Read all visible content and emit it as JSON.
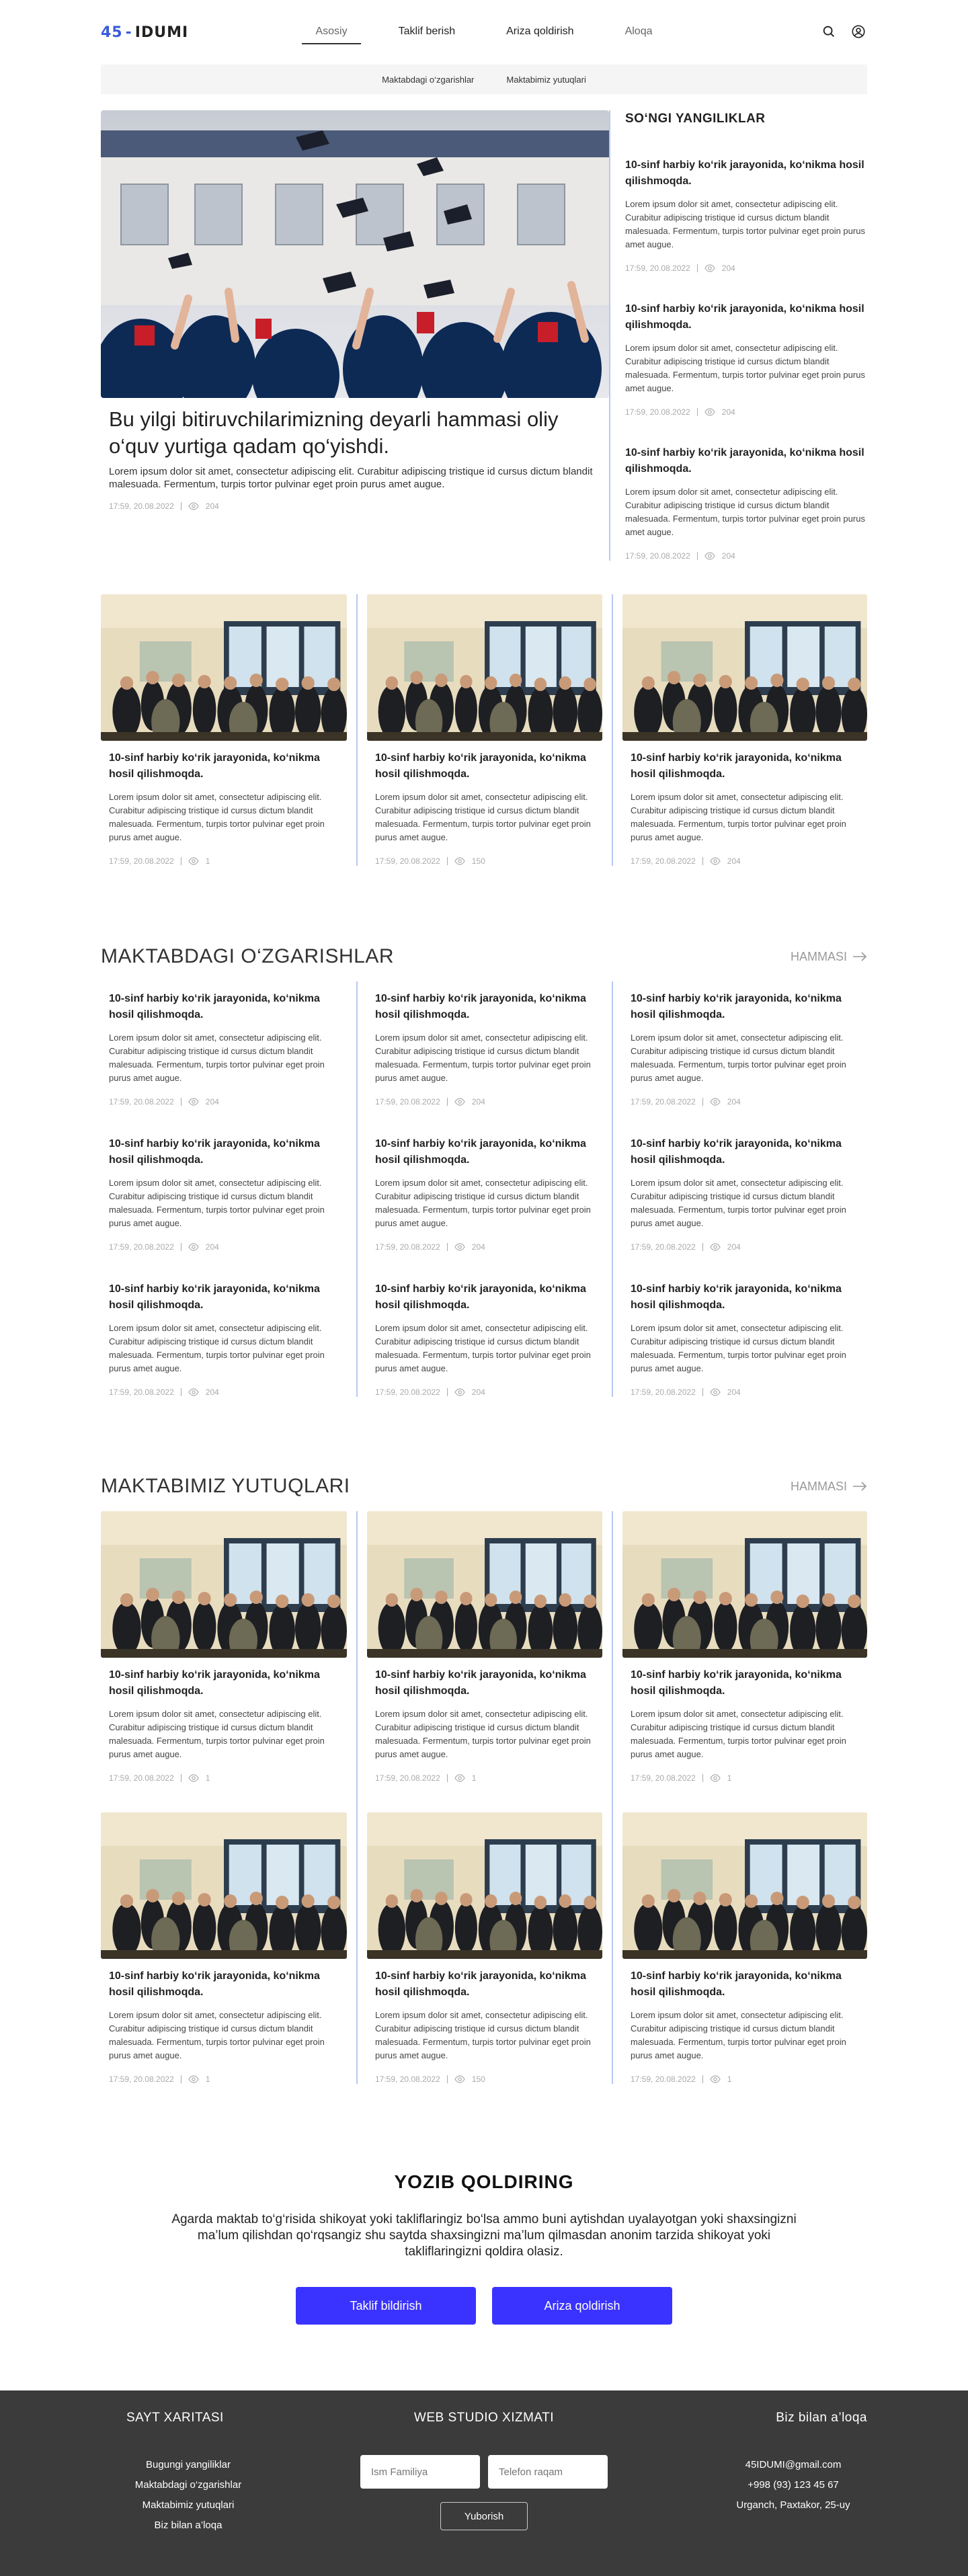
{
  "header": {
    "logo_num": "45",
    "logo_sep": "-",
    "logo_text": "IDUMI",
    "nav": [
      "Asosiy",
      "Taklif berish",
      "Ariza qoldirish",
      "Aloqa"
    ],
    "icons": [
      "search-icon",
      "user-icon"
    ]
  },
  "subnav": [
    "Maktabdagi o‘zgarishlar",
    "Maktabimiz yutuqlari"
  ],
  "featured": {
    "title": "Bu yilgi bitiruvchilarimizning deyarli hammasi oliy o‘quv yurtiga qadam qo‘yishdi.",
    "desc": "Lorem ipsum dolor sit amet, consectetur adipiscing elit. Curabitur adipiscing tristique id cursus dictum blandit malesuada. Fermentum, turpis tortor pulvinar eget proin purus amet augue.",
    "date": "17:59, 20.08.2022",
    "views": "204"
  },
  "latest": {
    "heading": "SO‘NGI YANGILIKLAR",
    "items": [
      {
        "title": "10-sinf  harbiy ko‘rik jarayonida, ko‘nikma hosil qilishmoqda.",
        "desc": "Lorem ipsum dolor sit amet, consectetur adipiscing elit. Curabitur adipiscing tristique id cursus dictum blandit malesuada. Fermentum, turpis tortor pulvinar eget proin purus amet augue.",
        "date": "17:59, 20.08.2022",
        "views": "204"
      },
      {
        "title": "10-sinf  harbiy ko‘rik jarayonida, ko‘nikma hosil qilishmoqda.",
        "desc": "Lorem ipsum dolor sit amet, consectetur adipiscing elit. Curabitur adipiscing tristique id cursus dictum blandit malesuada. Fermentum, turpis tortor pulvinar eget proin purus amet augue.",
        "date": "17:59, 20.08.2022",
        "views": "204"
      },
      {
        "title": "10-sinf  harbiy ko‘rik jarayonida, ko‘nikma hosil qilishmoqda.",
        "desc": "Lorem ipsum dolor sit amet, consectetur adipiscing elit. Curabitur adipiscing tristique id cursus dictum blandit malesuada. Fermentum, turpis tortor pulvinar eget proin purus amet augue.",
        "date": "17:59, 20.08.2022",
        "views": "204"
      }
    ]
  },
  "photo_news": [
    {
      "title": "10-sinf  harbiy ko‘rik jarayonida, ko‘nikma hosil qilishmoqda.",
      "desc": "Lorem ipsum dolor sit amet, consectetur adipiscing elit. Curabitur adipiscing tristique id cursus dictum blandit malesuada. Fermentum, turpis tortor pulvinar eget proin purus amet augue.",
      "date": "17:59, 20.08.2022",
      "views": "1"
    },
    {
      "title": "10-sinf  harbiy ko‘rik jarayonida, ko‘nikma hosil qilishmoqda.",
      "desc": "Lorem ipsum dolor sit amet, consectetur adipiscing elit. Curabitur adipiscing tristique id cursus dictum blandit malesuada. Fermentum, turpis tortor pulvinar eget proin purus amet augue.",
      "date": "17:59, 20.08.2022",
      "views": "150"
    },
    {
      "title": "10-sinf  harbiy ko‘rik jarayonida, ko‘nikma hosil qilishmoqda.",
      "desc": "Lorem ipsum dolor sit amet, consectetur adipiscing elit. Curabitur adipiscing tristique id cursus dictum blandit malesuada. Fermentum, turpis tortor pulvinar eget proin purus amet augue.",
      "date": "17:59, 20.08.2022",
      "views": "204"
    }
  ],
  "changes": {
    "heading": "MAKTABDAGI O‘ZGARISHLAR",
    "all_label": "HAMMASI",
    "item": {
      "title": "10-sinf  harbiy ko‘rik jarayonida, ko‘nikma hosil qilishmoqda.",
      "desc": "Lorem ipsum dolor sit amet, consectetur adipiscing elit. Curabitur adipiscing tristique id cursus dictum blandit malesuada. Fermentum, turpis tortor pulvinar eget proin purus amet augue.",
      "date": "17:59, 20.08.2022",
      "views": "204"
    }
  },
  "achievements": {
    "heading": "MAKTABIMIZ YUTUQLARI",
    "all_label": "HAMMASI",
    "items": [
      {
        "title": "10-sinf  harbiy ko‘rik jarayonida, ko‘nikma hosil qilishmoqda.",
        "desc": "Lorem ipsum dolor sit amet, consectetur adipiscing elit. Curabitur adipiscing tristique id cursus dictum blandit malesuada. Fermentum, turpis tortor pulvinar eget proin purus amet augue.",
        "date": "17:59, 20.08.2022",
        "views": "1"
      },
      {
        "title": "10-sinf  harbiy ko‘rik jarayonida, ko‘nikma hosil qilishmoqda.",
        "desc": "Lorem ipsum dolor sit amet, consectetur adipiscing elit. Curabitur adipiscing tristique id cursus dictum blandit malesuada. Fermentum, turpis tortor pulvinar eget proin purus amet augue.",
        "date": "17:59, 20.08.2022",
        "views": "1"
      },
      {
        "title": "10-sinf  harbiy ko‘rik jarayonida, ko‘nikma hosil qilishmoqda.",
        "desc": "Lorem ipsum dolor sit amet, consectetur adipiscing elit. Curabitur adipiscing tristique id cursus dictum blandit malesuada. Fermentum, turpis tortor pulvinar eget proin purus amet augue.",
        "date": "17:59, 20.08.2022",
        "views": "1"
      },
      {
        "title": "10-sinf  harbiy ko‘rik jarayonida, ko‘nikma hosil qilishmoqda.",
        "desc": "Lorem ipsum dolor sit amet, consectetur adipiscing elit. Curabitur adipiscing tristique id cursus dictum blandit malesuada. Fermentum, turpis tortor pulvinar eget proin purus amet augue.",
        "date": "17:59, 20.08.2022",
        "views": "1"
      },
      {
        "title": "10-sinf  harbiy ko‘rik jarayonida, ko‘nikma hosil qilishmoqda.",
        "desc": "Lorem ipsum dolor sit amet, consectetur adipiscing elit. Curabitur adipiscing tristique id cursus dictum blandit malesuada. Fermentum, turpis tortor pulvinar eget proin purus amet augue.",
        "date": "17:59, 20.08.2022",
        "views": "150"
      },
      {
        "title": "10-sinf  harbiy ko‘rik jarayonida, ko‘nikma hosil qilishmoqda.",
        "desc": "Lorem ipsum dolor sit amet, consectetur adipiscing elit. Curabitur adipiscing tristique id cursus dictum blandit malesuada. Fermentum, turpis tortor pulvinar eget proin purus amet augue.",
        "date": "17:59, 20.08.2022",
        "views": "1"
      }
    ]
  },
  "feedback": {
    "title": "YOZIB QOLDIRING",
    "text": "Agarda maktab to‘g‘risida shikoyat yoki takliflaringiz bo‘lsa ammo buni aytishdan uyalayotgan yoki shaxsingizni ma’lum qilishdan qo‘rqsangiz shu saytda shaxsingizni ma’lum qilmasdan anonim tarzida shikoyat yoki takliflaringizni qoldira olasiz.",
    "btn_suggest": "Taklif bildirish",
    "btn_request": "Ariza qoldirish",
    "accent": "#3a33ff"
  },
  "footer": {
    "sitemap_title": "SAYT XARITASI",
    "sitemap": [
      "Bugungi yangiliklar",
      "Maktabdagi o‘zgarishlar",
      "Maktabimiz yutuqlari",
      "Biz bilan a’loqa"
    ],
    "studio_title": "WEB STUDIO XIZMATI",
    "name_placeholder": "Ism Familiya",
    "phone_placeholder": "Telefon raqam",
    "send_label": "Yuborish",
    "contact_title": "Biz bilan a’loqa",
    "email": "45IDUMI@gmail.com",
    "phone": "+998 (93) 123 45 67",
    "address": "Urganch, Paxtakor, 25-uy",
    "bg": "#3b3b3b"
  }
}
